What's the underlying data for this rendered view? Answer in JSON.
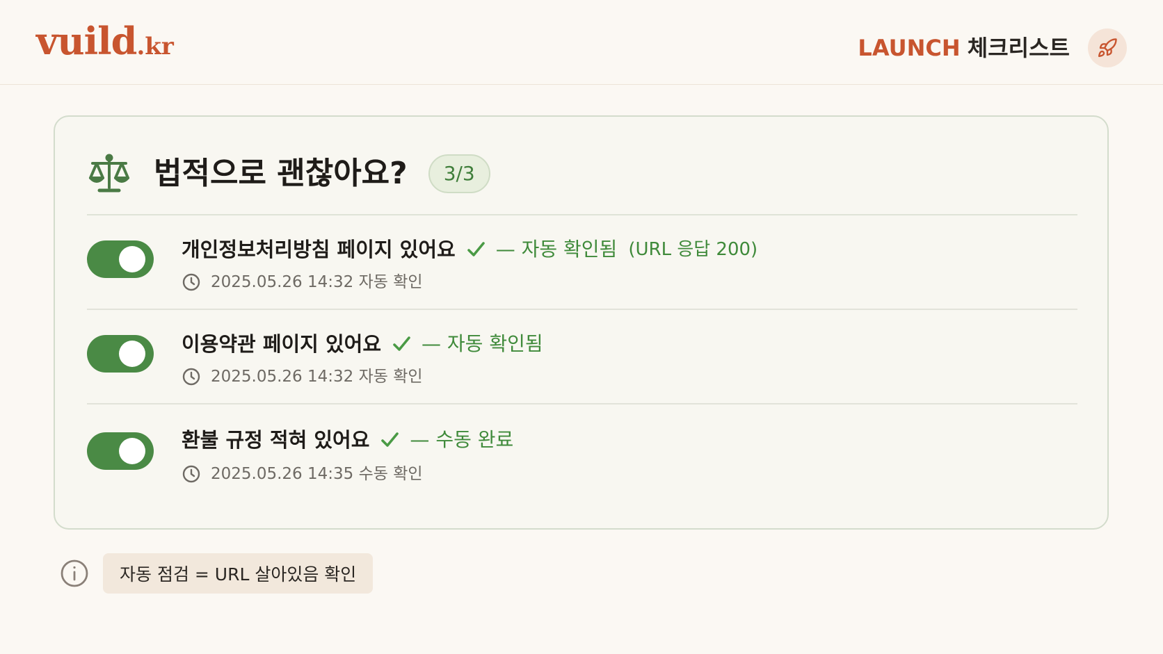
{
  "brand": {
    "name": "vuild",
    "tld": ".kr",
    "color": "#c8552f"
  },
  "header": {
    "title_accent": "LAUNCH",
    "title_rest": "체크리스트",
    "rocket_icon": "rocket-icon"
  },
  "section": {
    "icon": "scale-icon",
    "title": "법적으로 괜찮아요?",
    "count": "3/3",
    "items": [
      {
        "title": "개인정보처리방침 페이지 있어요",
        "checked": true,
        "status": "— 자동 확인됨",
        "status_note": "(URL 응답 200)",
        "timestamp": "2025.05.26 14:32 자동 확인"
      },
      {
        "title": "이용약관 페이지 있어요",
        "checked": true,
        "status": "— 자동 확인됨",
        "status_note": "",
        "timestamp": "2025.05.26 14:32 자동 확인"
      },
      {
        "title": "환불 규정 적혀 있어요",
        "checked": true,
        "status": "— 수동 완료",
        "status_note": "",
        "timestamp": "2025.05.26 14:35 수동 확인"
      }
    ]
  },
  "footer": {
    "icon": "info-icon",
    "note": "자동 점검 = URL 살아있음 확인"
  },
  "colors": {
    "accent": "#c8552f",
    "success": "#4a8a45",
    "background": "#fbf8f3"
  }
}
